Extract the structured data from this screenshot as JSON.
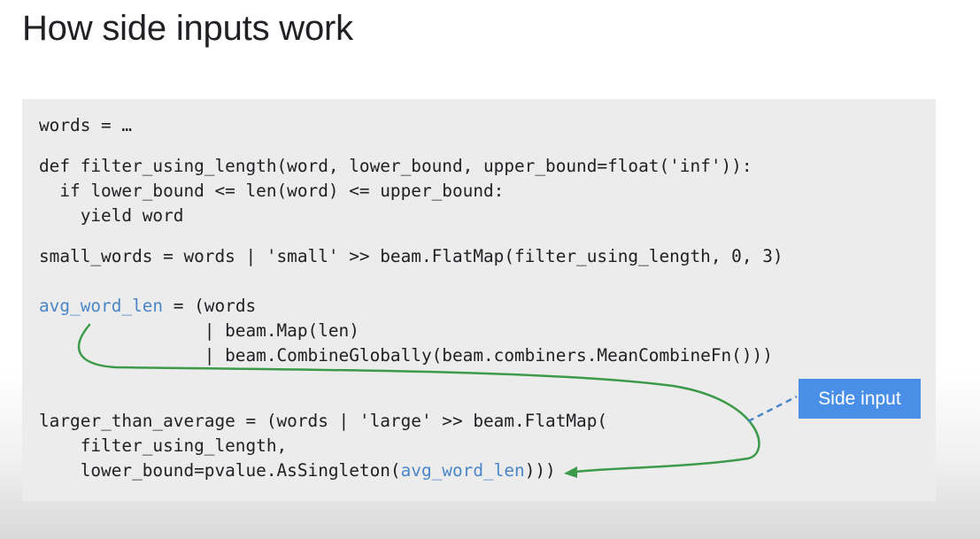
{
  "slide": {
    "title": "How side inputs work"
  },
  "code": {
    "line1": "words = …",
    "line2": "def filter_using_length(word, lower_bound, upper_bound=float('inf')):",
    "line3": "  if lower_bound <= len(word) <= upper_bound:",
    "line4": "    yield word",
    "line5": "small_words = words | 'small' >> beam.FlatMap(filter_using_length, 0, 3)",
    "line6_var": "avg_word_len",
    "line6_rest": " = (words",
    "line7": "                | beam.Map(len)",
    "line8": "                | beam.CombineGlobally(beam.combiners.MeanCombineFn()))",
    "line9": "larger_than_average = (words | 'large' >> beam.FlatMap(",
    "line10": "    filter_using_length,",
    "line11_pre": "    lower_bound=pvalue.AsSingleton(",
    "line11_var": "avg_word_len",
    "line11_post": ")))"
  },
  "annotation": {
    "label": "Side input"
  },
  "colors": {
    "highlight": "#4a86c8",
    "arrow": "#3c9a4a",
    "label_bg": "#4a8fe7",
    "dashed_connector": "#4a86c8"
  }
}
